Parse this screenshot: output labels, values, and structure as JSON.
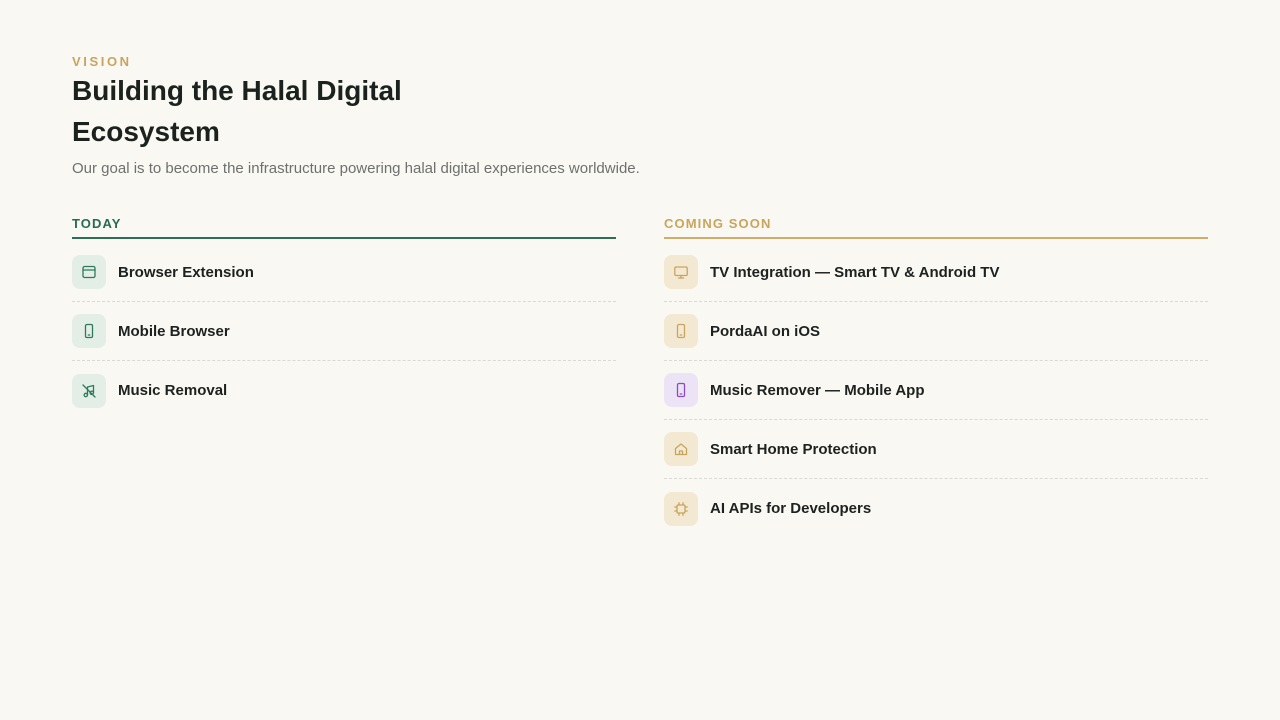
{
  "header": {
    "eyebrow": "VISION",
    "title": "Building the Halal Digital Ecosystem",
    "subtitle": "Our goal is to become the infrastructure powering halal digital experiences worldwide."
  },
  "today": {
    "heading": "TODAY",
    "accent_color": "#2c6e56",
    "items": [
      {
        "label": "Browser Extension",
        "icon": "browser-window-icon"
      },
      {
        "label": "Mobile Browser",
        "icon": "smartphone-icon"
      },
      {
        "label": "Music Removal",
        "icon": "music-off-icon"
      }
    ]
  },
  "coming_soon": {
    "heading": "COMING SOON",
    "accent_color": "#d2ad69",
    "items": [
      {
        "label": "TV Integration — Smart TV & Android TV",
        "icon": "tv-icon"
      },
      {
        "label": "PordaAI on iOS",
        "icon": "smartphone-icon"
      },
      {
        "label": "Music Remover — Mobile App",
        "icon": "smartphone-icon",
        "icon_color": "#8a4cc4"
      },
      {
        "label": "Smart Home Protection",
        "icon": "home-icon"
      },
      {
        "label": "AI APIs for Developers",
        "icon": "cpu-chip-icon"
      }
    ]
  }
}
